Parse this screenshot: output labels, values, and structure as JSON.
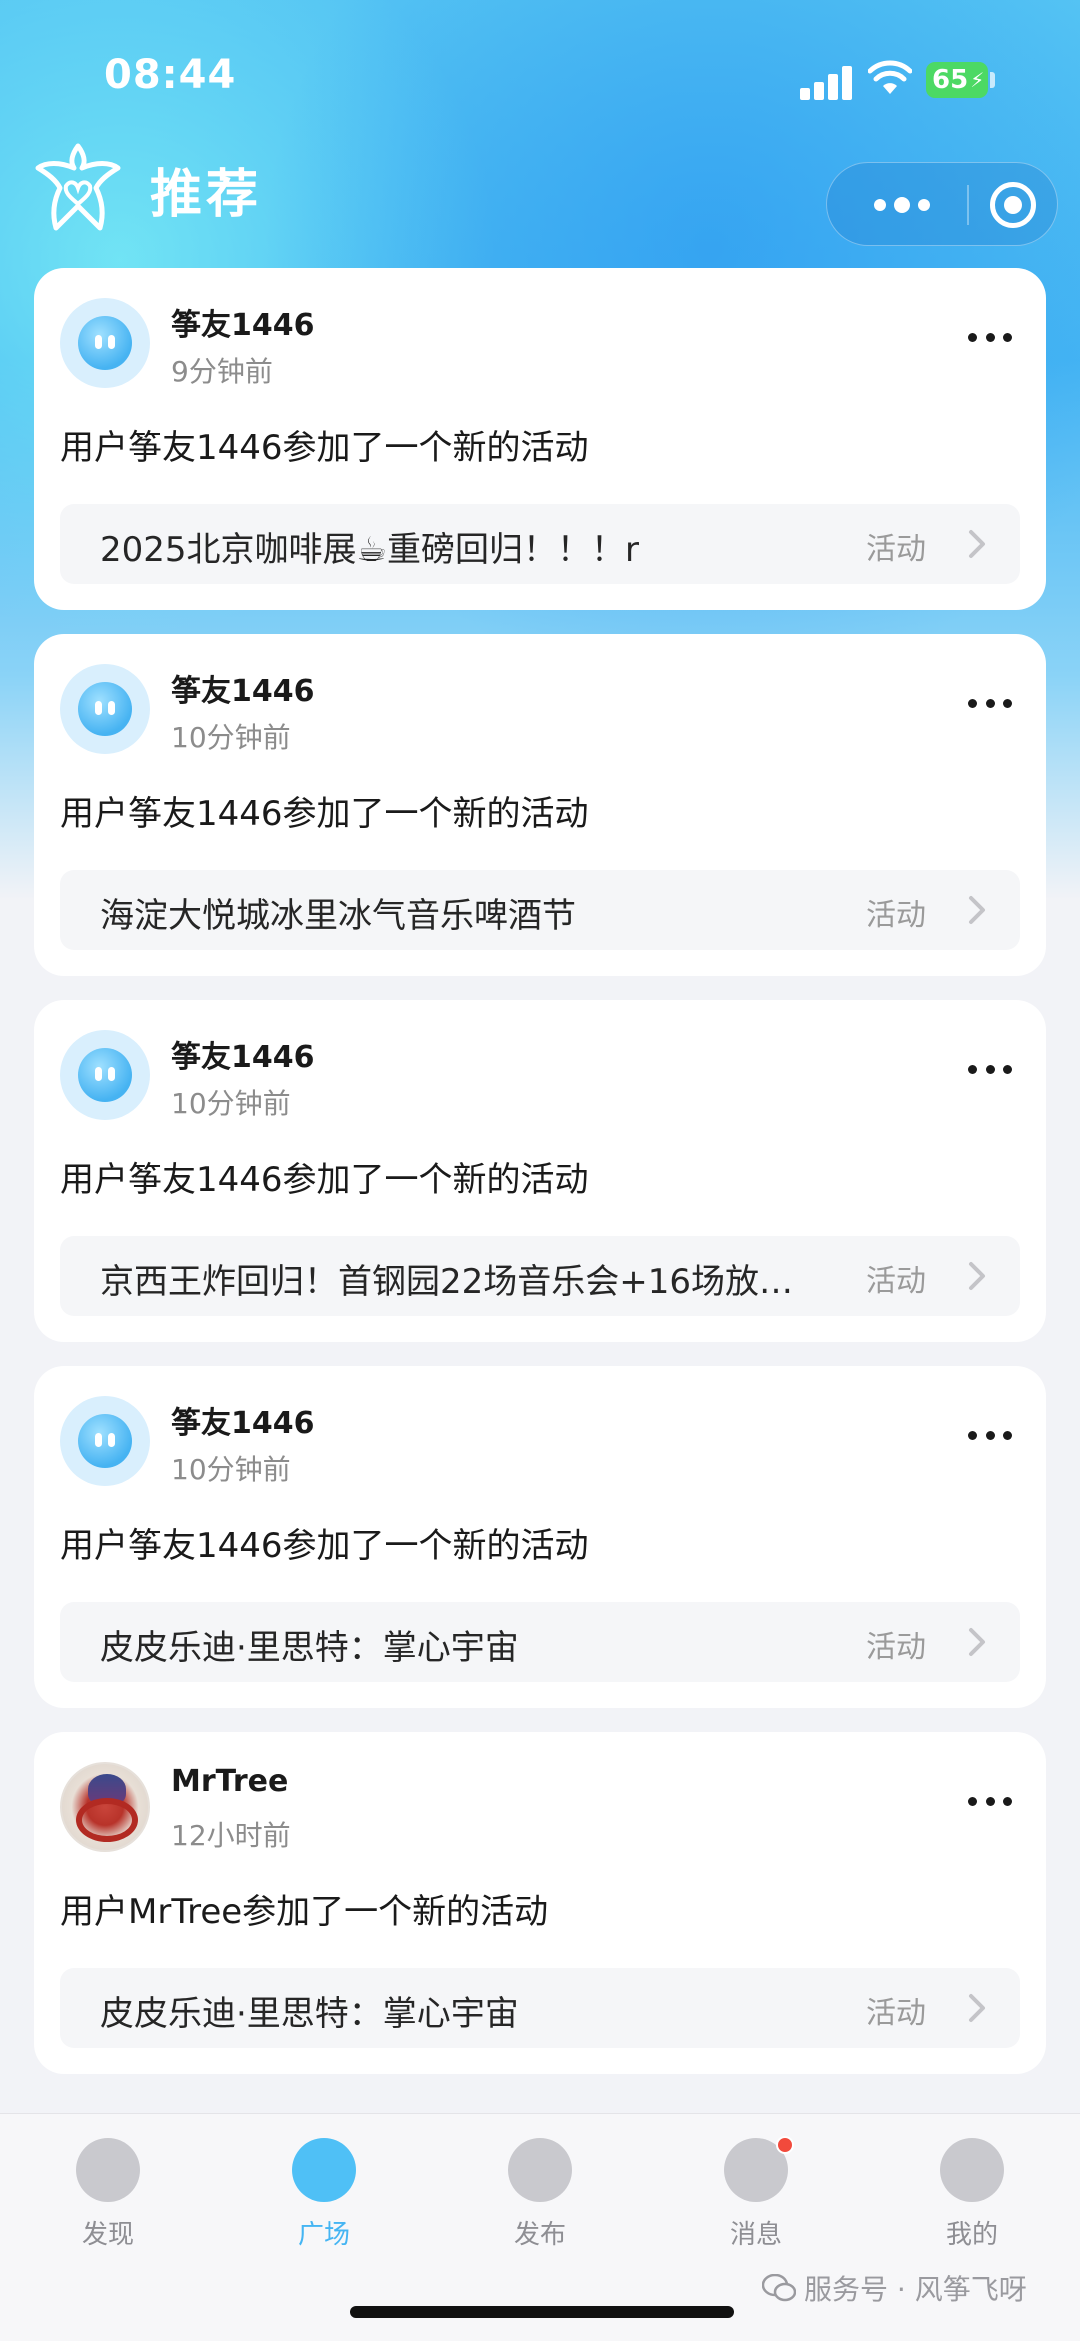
{
  "status_bar": {
    "time": "08:44",
    "battery": "65"
  },
  "header": {
    "title": "推荐"
  },
  "feed": [
    {
      "username": "筝友1446",
      "time": "9分钟前",
      "text": "用户筝友1446参加了一个新的活动",
      "activity_title": "2025北京咖啡展☕重磅回归！！！r",
      "activity_tag": "活动",
      "avatar": "kite-mascot"
    },
    {
      "username": "筝友1446",
      "time": "10分钟前",
      "text": "用户筝友1446参加了一个新的活动",
      "activity_title": "海淀大悦城冰里冰气音乐啤酒节",
      "activity_tag": "活动",
      "avatar": "kite-mascot"
    },
    {
      "username": "筝友1446",
      "time": "10分钟前",
      "text": "用户筝友1446参加了一个新的活动",
      "activity_title": "京西王炸回归！首钢园22场音乐会+16场放…",
      "activity_tag": "活动",
      "avatar": "kite-mascot"
    },
    {
      "username": "筝友1446",
      "time": "10分钟前",
      "text": "用户筝友1446参加了一个新的活动",
      "activity_title": "皮皮乐迪·里思特：掌心宇宙",
      "activity_tag": "活动",
      "avatar": "kite-mascot"
    },
    {
      "username": "MrTree",
      "time": "12小时前",
      "text": "用户MrTree参加了一个新的活动",
      "activity_title": "皮皮乐迪·里思特：掌心宇宙",
      "activity_tag": "活动",
      "avatar": "photo"
    }
  ],
  "tabbar": {
    "items": [
      {
        "label": "发现",
        "icon": "planet-icon",
        "active": false
      },
      {
        "label": "广场",
        "icon": "compass-icon",
        "active": true
      },
      {
        "label": "发布",
        "icon": "plus-icon",
        "active": false
      },
      {
        "label": "消息",
        "icon": "message-icon",
        "active": false,
        "badge": true
      },
      {
        "label": "我的",
        "icon": "profile-icon",
        "active": false
      }
    ]
  },
  "watermark": "服务号 · 风筝飞呀",
  "colors": {
    "accent": "#45b5f3",
    "badge": "#f24a3c",
    "battery": "#4cd964"
  }
}
